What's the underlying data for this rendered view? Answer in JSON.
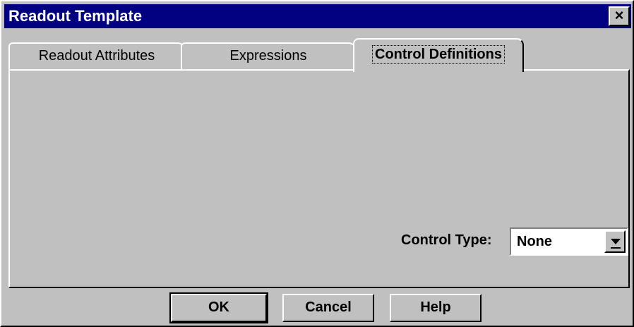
{
  "window": {
    "title": "Readout Template",
    "close_glyph": "×"
  },
  "tabs": [
    {
      "label": "Readout Attributes",
      "active": false
    },
    {
      "label": "Expressions",
      "active": false
    },
    {
      "label": "Control Definitions",
      "active": true
    }
  ],
  "control_type": {
    "label": "Control Type:",
    "value": "None",
    "button_icon": "dropdown-arrow-icon"
  },
  "buttons": {
    "ok": "OK",
    "cancel": "Cancel",
    "help": "Help"
  },
  "colors": {
    "titlebar": "#000080",
    "face": "#c0c0c0"
  }
}
